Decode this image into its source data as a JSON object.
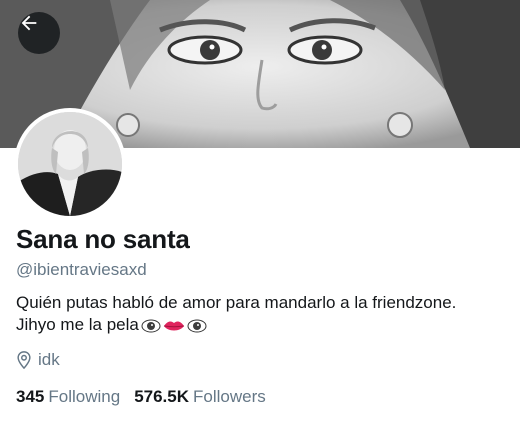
{
  "profile": {
    "display_name": "Sana no santa",
    "handle": "@ibientraviesaxd",
    "bio_line1": "Quién putas habló de amor para mandarlo a la friendzone.",
    "bio_line2": "Jihyo me la pela",
    "location": "idk"
  },
  "stats": {
    "following_count": "345",
    "following_label": "Following",
    "followers_count": "576.5K",
    "followers_label": "Followers"
  },
  "icons": {
    "back": "arrow-left-icon",
    "location": "location-pin-icon",
    "bio_emoji": [
      "eye-icon",
      "lips-icon",
      "eye-icon"
    ]
  },
  "colors": {
    "text_primary": "#14171a",
    "text_secondary": "#657786"
  }
}
